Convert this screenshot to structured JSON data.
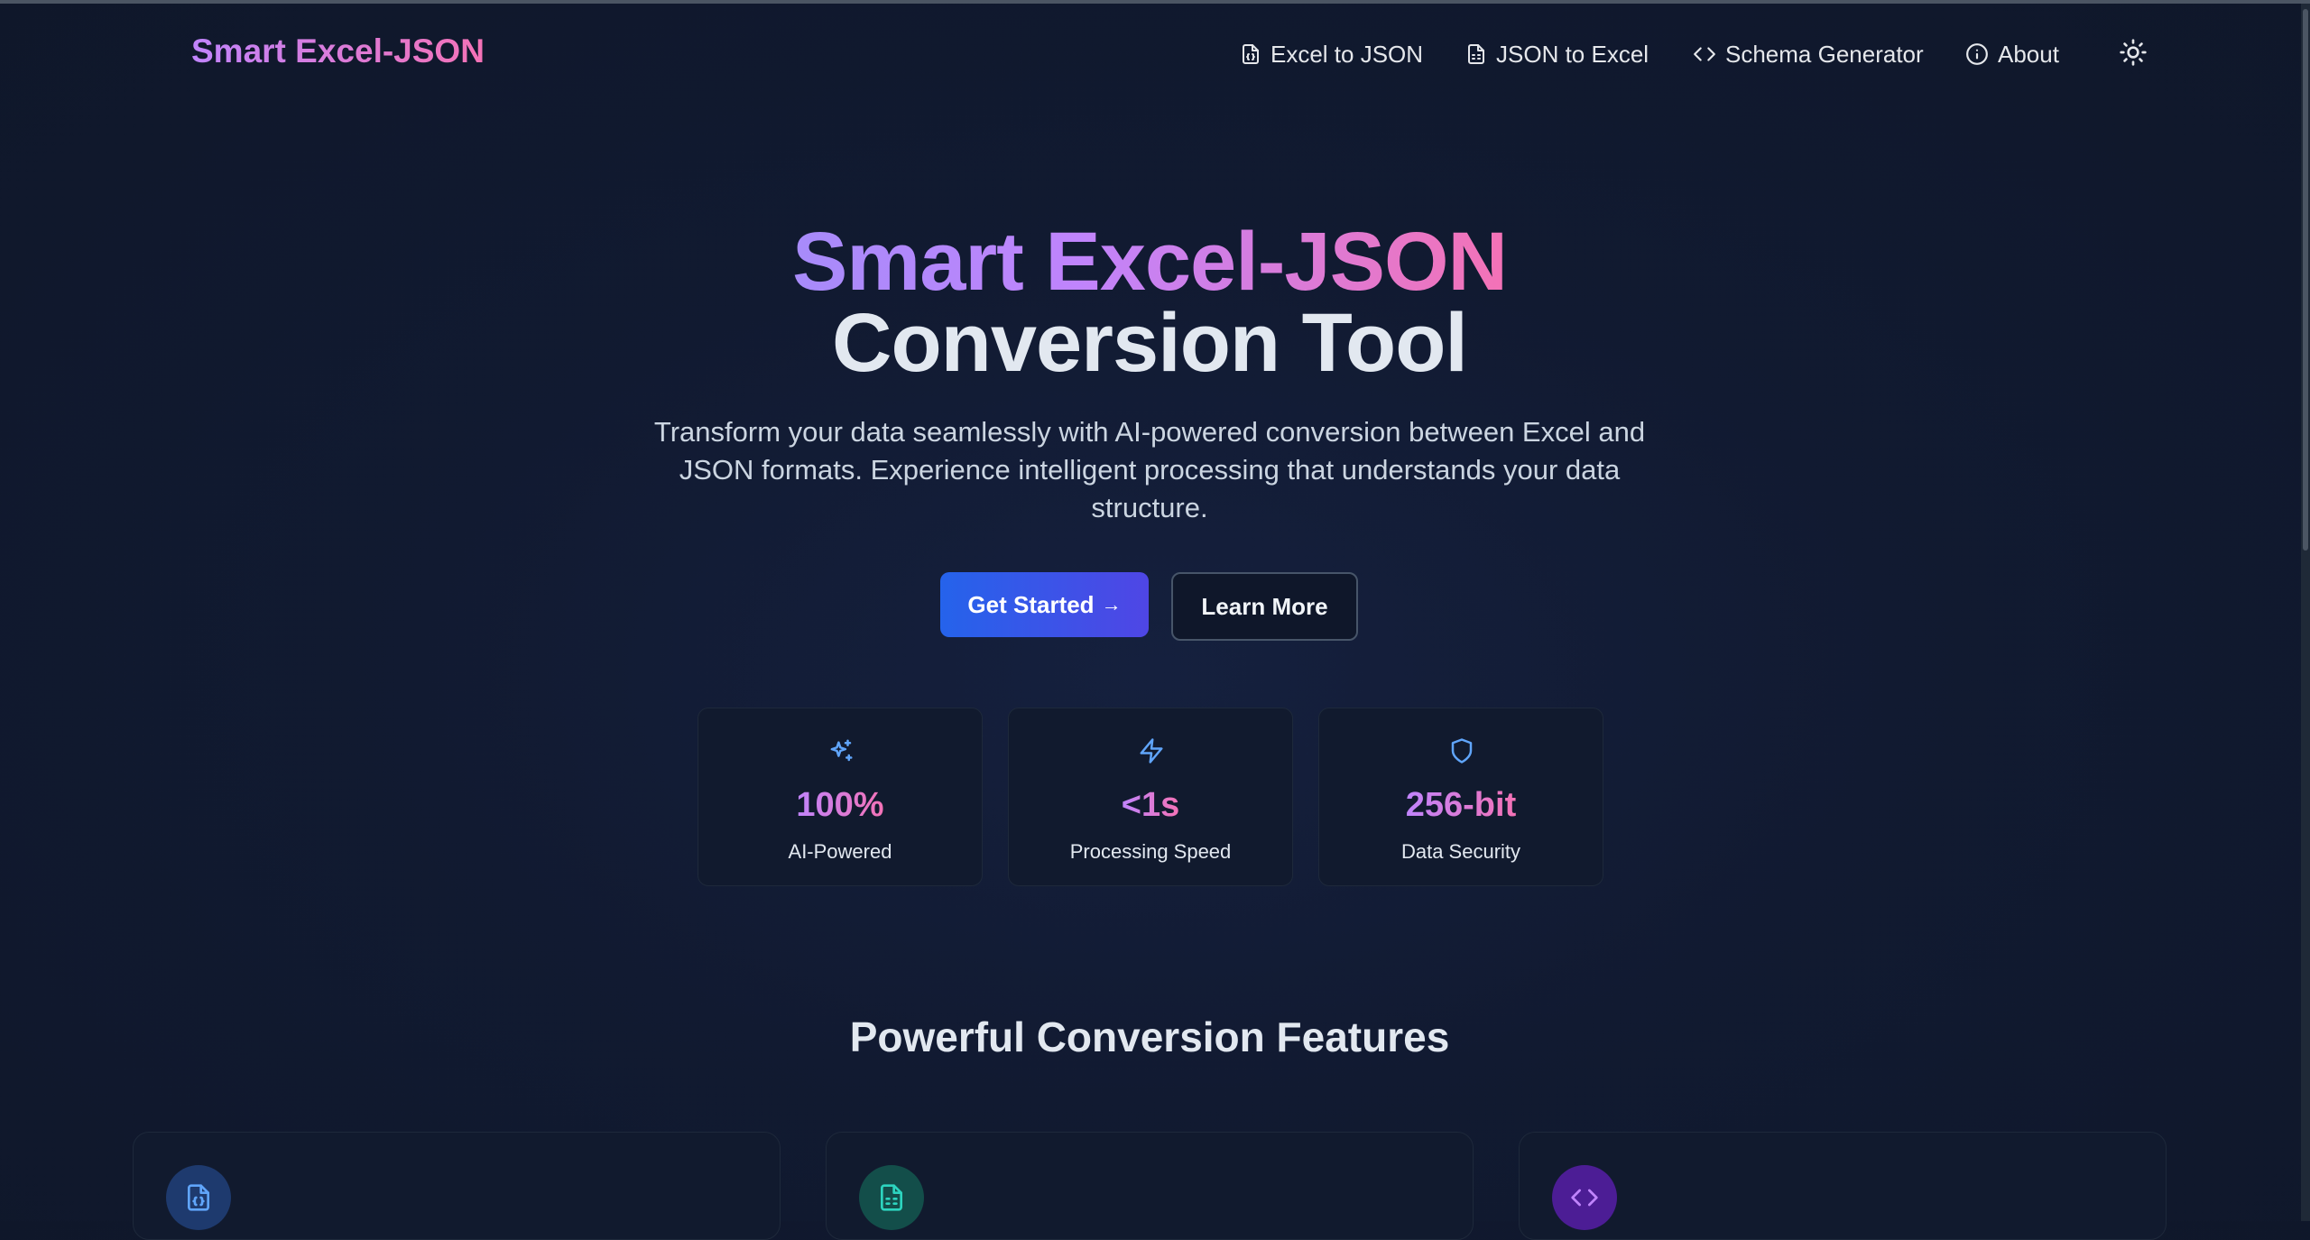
{
  "brand": "Smart Excel-JSON",
  "nav": {
    "excel_to_json": "Excel to JSON",
    "json_to_excel": "JSON to Excel",
    "schema_generator": "Schema Generator",
    "about": "About",
    "theme_toggle_icon": "sun-icon"
  },
  "hero": {
    "title_gradient": "Smart Excel-JSON",
    "title_plain": "Conversion Tool",
    "subtitle": "Transform your data seamlessly with AI-powered conversion between Excel and JSON formats. Experience intelligent processing that understands your data structure.",
    "get_started": "Get Started",
    "learn_more": "Learn More"
  },
  "stats": [
    {
      "icon": "sparkles-icon",
      "value": "100%",
      "label": "AI-Powered"
    },
    {
      "icon": "lightning-icon",
      "value": "<1s",
      "label": "Processing Speed"
    },
    {
      "icon": "shield-icon",
      "value": "256-bit",
      "label": "Data Security"
    }
  ],
  "features": {
    "title": "Powerful Conversion Features",
    "cards": [
      {
        "icon": "file-json-icon"
      },
      {
        "icon": "file-spreadsheet-icon"
      },
      {
        "icon": "code-icon"
      }
    ]
  },
  "colors": {
    "accent_blue": "#2563eb",
    "accent_indigo": "#4f46e5",
    "gradient_purple": "#c084fc",
    "gradient_pink": "#f472b6",
    "background": "#0f172a"
  }
}
